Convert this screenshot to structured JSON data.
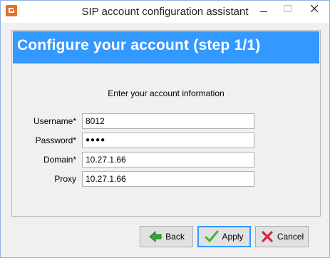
{
  "window": {
    "title": "SIP account configuration assistant"
  },
  "banner": {
    "title": "Configure your account (step 1/1)"
  },
  "form": {
    "prompt": "Enter your account information",
    "fields": [
      {
        "label": "Username*",
        "value": "8012",
        "type": "text"
      },
      {
        "label": "Password*",
        "value": "●●●●",
        "type": "password"
      },
      {
        "label": "Domain*",
        "value": "10.27.1.66",
        "type": "text"
      },
      {
        "label": "Proxy",
        "value": "10.27.1.66",
        "type": "text"
      }
    ]
  },
  "buttons": {
    "back": "Back",
    "apply": "Apply",
    "cancel": "Cancel"
  },
  "colors": {
    "banner": "#3399ff",
    "back_arrow": "#3aa63a",
    "apply_check": "#4caf2e",
    "cancel_x": "#d3263b"
  }
}
